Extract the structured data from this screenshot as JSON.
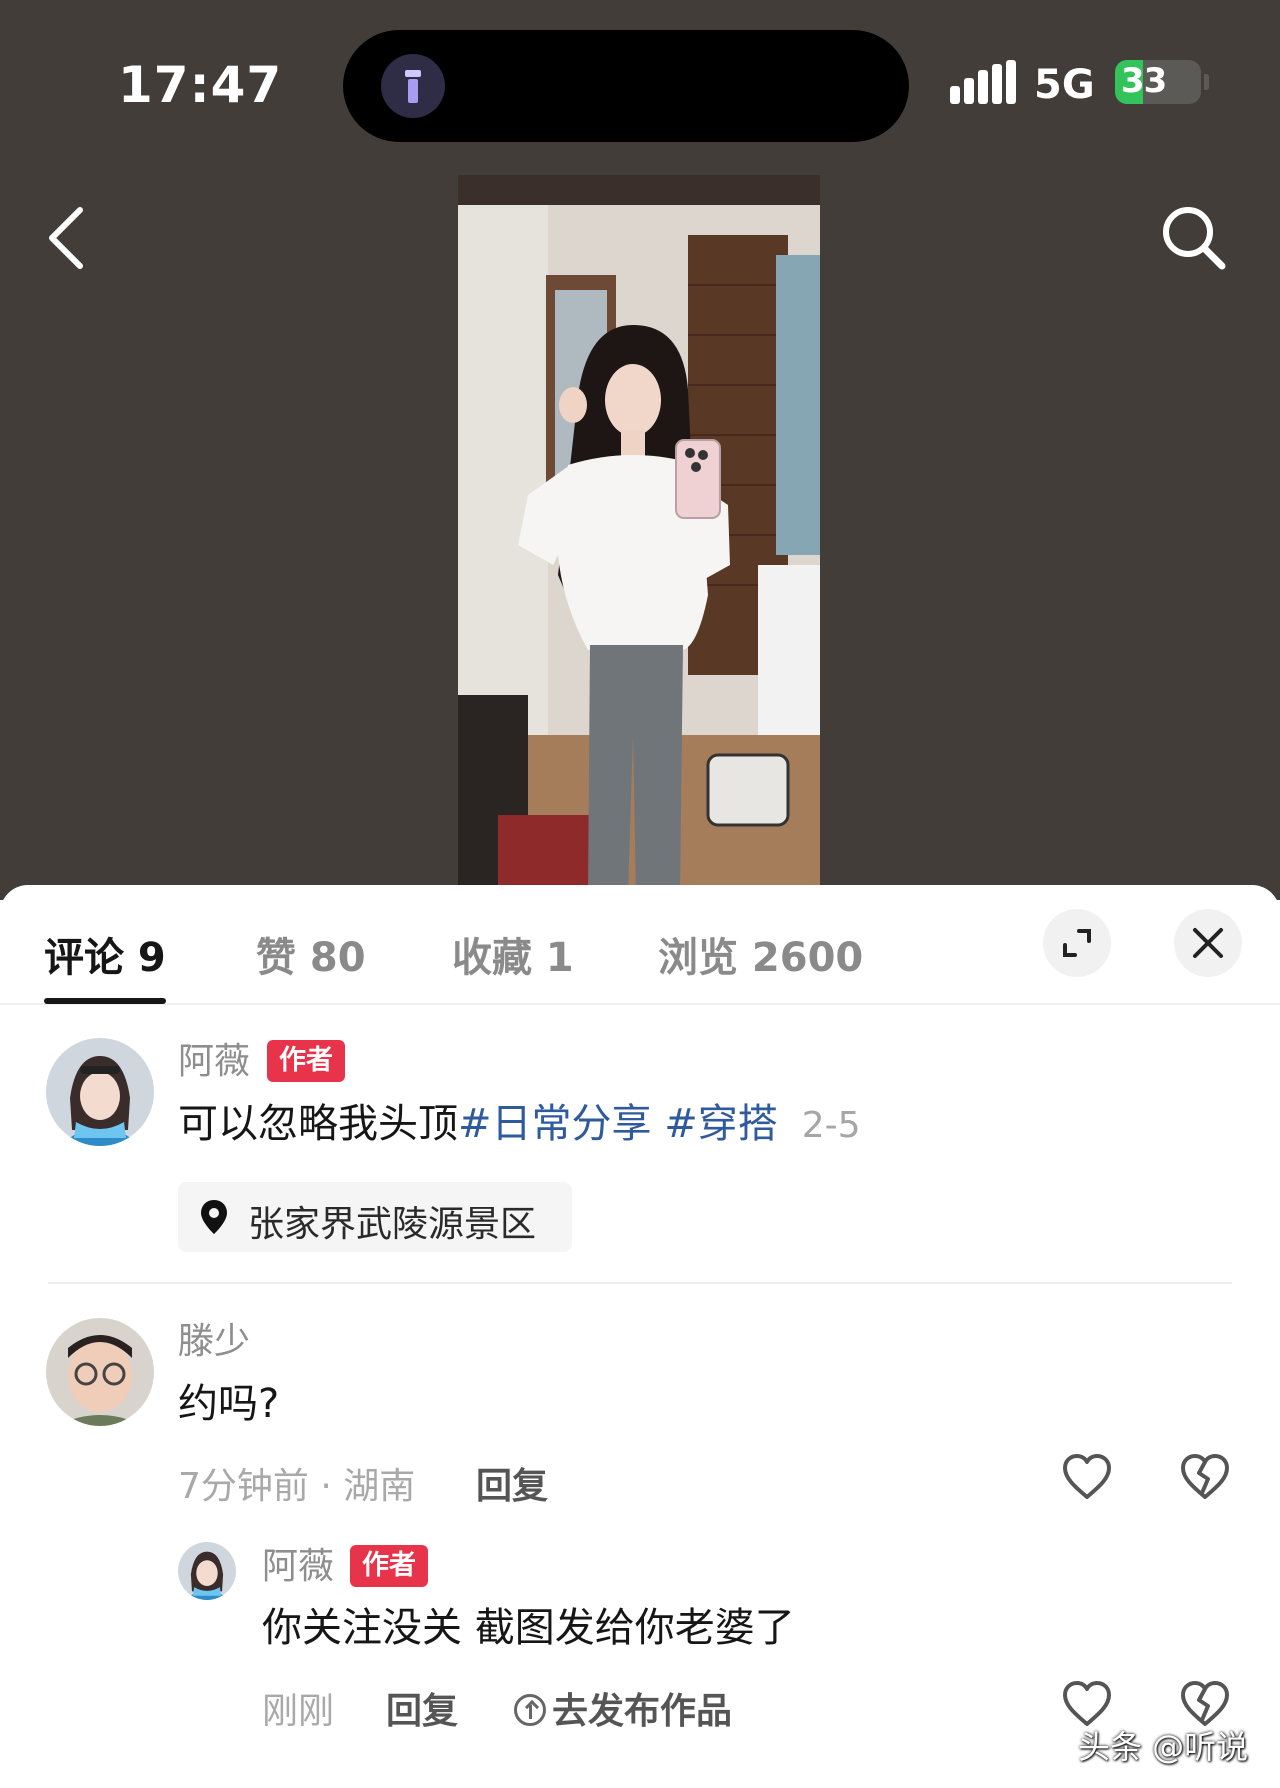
{
  "status_bar": {
    "time": "17:47",
    "network": "5G",
    "battery": "33",
    "battery_level_percent": 33
  },
  "header": {
    "back_icon": "chevron-left-icon",
    "search_icon": "search-icon"
  },
  "tabs": [
    {
      "label": "评论 9",
      "active": true
    },
    {
      "label": "赞 80",
      "active": false
    },
    {
      "label": "收藏 1",
      "active": false
    },
    {
      "label": "浏览 2600",
      "active": false
    }
  ],
  "post": {
    "author_name": "阿薇",
    "author_badge": "作者",
    "text": "可以忽略我头顶",
    "hashtags": [
      "#日常分享",
      "#穿搭"
    ],
    "date": "2-5",
    "location": "张家界武陵源景区"
  },
  "comments": [
    {
      "user": "滕少",
      "text": "约吗?",
      "meta": "7分钟前 · 湖南",
      "reply_label": "回复",
      "replies": [
        {
          "user": "阿薇",
          "badge": "作者",
          "text": "你关注没关 截图发给你老婆了",
          "meta": "刚刚",
          "reply_label": "回复",
          "publish_label": "去发布作品"
        }
      ]
    }
  ],
  "watermark": "头条 @听说",
  "colors": {
    "badge": "#e8344b",
    "hashtag": "#2f5a9e",
    "battery": "#33c35a",
    "header_bg": "#433d3a"
  }
}
